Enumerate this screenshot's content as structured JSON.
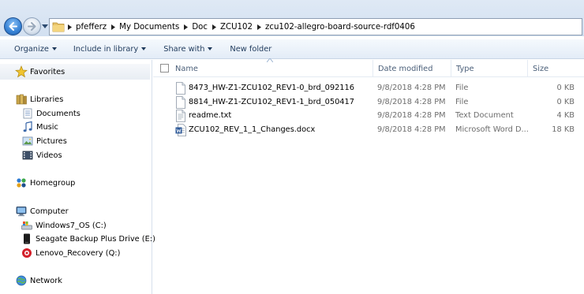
{
  "address_bar": {
    "breadcrumbs": [
      "pfefferz",
      "My Documents",
      "Doc",
      "ZCU102",
      "zcu102-allegro-board-source-rdf0406"
    ]
  },
  "command_bar": {
    "organize": "Organize",
    "include_in_library": "Include in library",
    "share_with": "Share with",
    "new_folder": "New folder"
  },
  "nav_pane": {
    "favorites": "Favorites",
    "libraries": "Libraries",
    "library_items": [
      "Documents",
      "Music",
      "Pictures",
      "Videos"
    ],
    "homegroup": "Homegroup",
    "computer": "Computer",
    "drives": [
      "Windows7_OS (C:)",
      "Seagate Backup Plus Drive (E:)",
      "Lenovo_Recovery (Q:)"
    ],
    "network": "Network"
  },
  "columns": {
    "name": "Name",
    "date": "Date modified",
    "type": "Type",
    "size": "Size"
  },
  "files": [
    {
      "name": "8473_HW-Z1-ZCU102_REV1-0_brd_092116",
      "date": "9/8/2018 4:28 PM",
      "type": "File",
      "size": "0 KB",
      "icon": "file-icon"
    },
    {
      "name": "8814_HW-Z1-ZCU102_REV1-1_brd_050417",
      "date": "9/8/2018 4:28 PM",
      "type": "File",
      "size": "0 KB",
      "icon": "file-icon"
    },
    {
      "name": "readme.txt",
      "date": "9/8/2018 4:28 PM",
      "type": "Text Document",
      "size": "4 KB",
      "icon": "text-file-icon"
    },
    {
      "name": "ZCU102_REV_1_1_Changes.docx",
      "date": "9/8/2018 4:28 PM",
      "type": "Microsoft Word D...",
      "size": "18 KB",
      "icon": "word-doc-icon"
    }
  ],
  "colors": {
    "chrome_top": "#dfe9f5",
    "text_primary": "#000000",
    "text_secondary": "#6d6d6d",
    "header_text": "#4c607a",
    "accent_blue": "#3b86d8"
  }
}
